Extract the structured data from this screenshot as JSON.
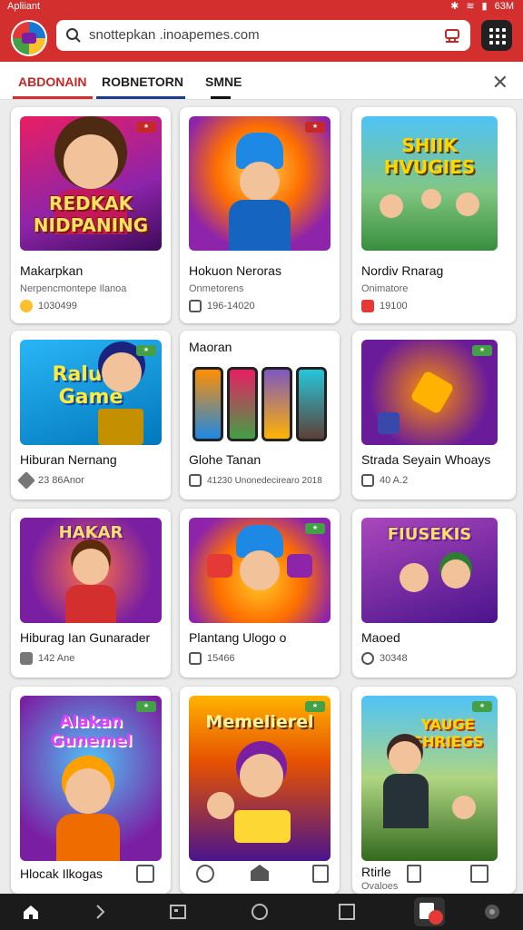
{
  "status": {
    "left_text": "Apliiant",
    "right_text": "63M"
  },
  "search": {
    "value": "snottepkan .inoapemes.com"
  },
  "tabs": [
    {
      "label": "ABDONAIN",
      "active": true
    },
    {
      "label": "ROBNETORN",
      "active": false
    },
    {
      "label": "SMNE",
      "active": false
    }
  ],
  "colors": {
    "brand": "#d32f2f",
    "accent_blue": "#1e88e5",
    "nav_bg": "#1b1b1b"
  },
  "cards": [
    {
      "thumb_text": "REDKAK NIDPANING",
      "title": "Makarpkan",
      "subtitle": "Nerpencmontepe Ilanoa",
      "meta": "1030499",
      "meta_icon": "coin-icon"
    },
    {
      "thumb_text": "",
      "title": "Hokuon Neroras",
      "subtitle": "Onmetorens",
      "meta": "196-14020",
      "meta_icon": "square-icon"
    },
    {
      "thumb_text": "SHIIK HVUGIES",
      "title": "Nordiv Rnarag",
      "subtitle": "Onimatore",
      "meta": "19100",
      "meta_icon": "app-icon"
    },
    {
      "thumb_text": "Raluao Game",
      "title": "Hiburan Nernang",
      "subtitle": "",
      "meta": "23 86Anor",
      "meta_icon": "tag-icon"
    },
    {
      "thumb_text": "",
      "title": "Glohe Tanan",
      "subtitle": "",
      "header": "Maoran",
      "meta": "41230 Unonedecirearo 2018",
      "meta_icon": "square-icon"
    },
    {
      "thumb_text": "",
      "title": "Strada Seyain Whoays",
      "subtitle": "",
      "meta": "40 A.2",
      "meta_icon": "square-icon"
    },
    {
      "thumb_text": "HAKAR",
      "title": "Hiburag Ian Gunarader",
      "subtitle": "",
      "meta": "142 Ane",
      "meta_icon": "thumb-icon"
    },
    {
      "thumb_text": "",
      "title": "Plantang Ulogo o",
      "subtitle": "",
      "meta": "15466",
      "meta_icon": "square-icon"
    },
    {
      "thumb_text": "FIUSEKIS",
      "title": "Maoed",
      "subtitle": "",
      "meta": "30348",
      "meta_icon": "circle-icon"
    },
    {
      "thumb_text": "Alakan Gunemel",
      "title": "Hlocak Ilkogas",
      "subtitle": "",
      "meta": "",
      "meta_icon": ""
    },
    {
      "thumb_text": "Memelierel",
      "title": "",
      "subtitle": "",
      "meta": "",
      "meta_icon": ""
    },
    {
      "thumb_text": "YAUGE SHRIEGS",
      "title": "Rtirle",
      "subtitle": "Ovaloes",
      "meta": "",
      "meta_icon": ""
    }
  ],
  "bottom_nav": [
    "home-icon",
    "forward-icon",
    "window-icon",
    "circle-icon",
    "square-icon",
    "app-badge-icon",
    "assistant-icon"
  ]
}
